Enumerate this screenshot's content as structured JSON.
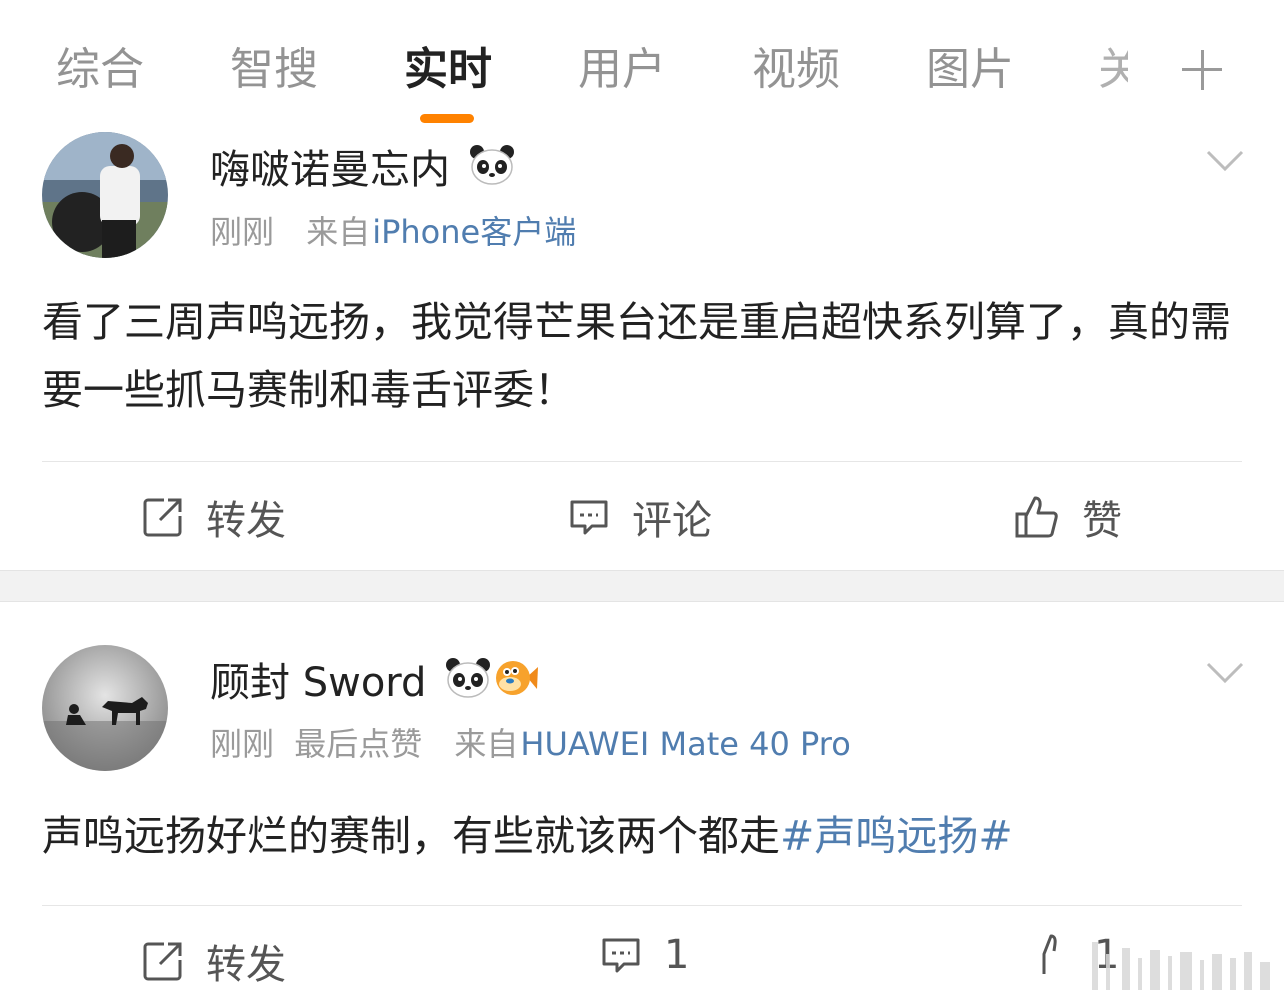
{
  "tabs": [
    {
      "label": "综合",
      "active": false
    },
    {
      "label": "智搜",
      "active": false
    },
    {
      "label": "实时",
      "active": true
    },
    {
      "label": "用户",
      "active": false
    },
    {
      "label": "视频",
      "active": false
    },
    {
      "label": "图片",
      "active": false
    },
    {
      "label": "关",
      "active": false
    }
  ],
  "accent_color": "#ff8200",
  "link_color": "#507daf",
  "posts": [
    {
      "username": "嗨啵诺曼忘内",
      "badges": [
        "panda-icon"
      ],
      "time": "刚刚",
      "from_prefix": "来自",
      "source": "iPhone客户端",
      "content": "看了三周声鸣远扬，我觉得芒果台还是重启超快系列算了，真的需要一些抓马赛制和毒舌评委！",
      "actions": {
        "repost": "转发",
        "comment": "评论",
        "like": "赞"
      }
    },
    {
      "username": "顾封 Sword",
      "badges": [
        "panda-icon",
        "puffer-fish-icon"
      ],
      "time": "刚刚",
      "extra": "最后点赞",
      "from_prefix": "来自",
      "source": "HUAWEI Mate 40 Pro",
      "content_text": "声鸣远扬好烂的赛制，有些就该两个都走",
      "content_topic": "#声鸣远扬#",
      "actions": {
        "repost": "转发",
        "comment": "1",
        "like": "1"
      }
    }
  ]
}
